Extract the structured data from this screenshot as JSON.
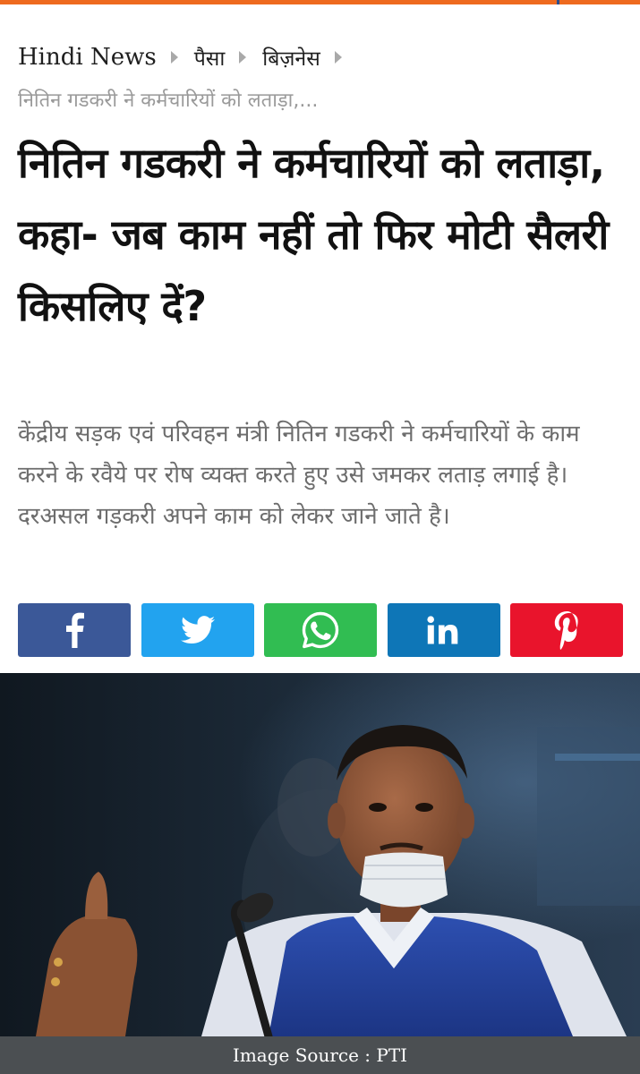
{
  "brand": {
    "accent": "#ee6a1f",
    "accent_secondary": "#2b4f8f"
  },
  "breadcrumb": {
    "items": [
      {
        "label": "Hindi News"
      },
      {
        "label": "पैसा"
      },
      {
        "label": "बिज़नेस"
      }
    ],
    "current": "नितिन गडकरी ने कर्मचारियों को लताड़ा,..."
  },
  "article": {
    "headline": "नितिन गडकरी ने कर्मचारियों को लताड़ा, कहा- जब काम नहीं तो फिर मोटी सैलरी किसलिए दें?",
    "summary": "केंद्रीय सड़क एवं परिवहन मंत्री नितिन गडकरी ने कर्मचारियों के काम करने के रवैये पर रोष व्यक्त करते हुए उसे जमकर लताड़ लगाई है। दरअसल गड़करी अपने काम को लेकर जाने जाते है।"
  },
  "share": {
    "buttons": [
      {
        "network": "facebook",
        "icon": "facebook-icon",
        "color": "#3b5898"
      },
      {
        "network": "twitter",
        "icon": "twitter-icon",
        "color": "#22a3ef"
      },
      {
        "network": "whatsapp",
        "icon": "whatsapp-icon",
        "color": "#31bd52"
      },
      {
        "network": "linkedin",
        "icon": "linkedin-icon",
        "color": "#0e76b7"
      },
      {
        "network": "pinterest",
        "icon": "pinterest-icon",
        "color": "#e9142c"
      }
    ]
  },
  "image": {
    "caption": "Image Source : PTI"
  }
}
